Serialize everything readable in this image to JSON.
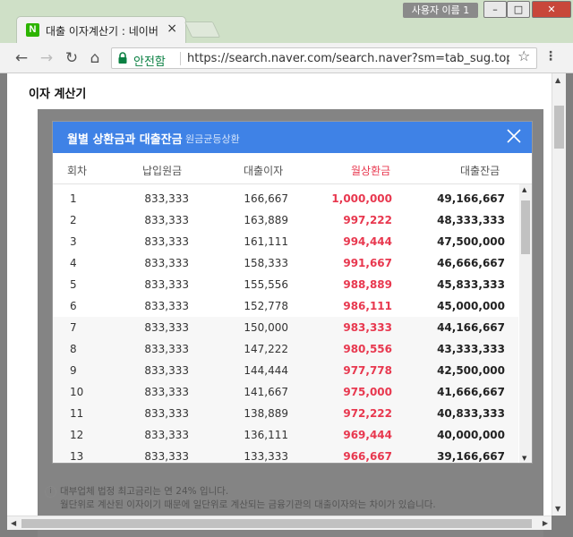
{
  "window": {
    "tab_title": "대출 이자계산기 : 네이버",
    "tab_close": "×",
    "profile": "사용자 이름 1",
    "min": "–",
    "max": "□",
    "close": "✕"
  },
  "toolbar": {
    "secure_label": "안전함",
    "url": "https://search.naver.com/search.naver?sm=tab_sug.top&..."
  },
  "page": {
    "title": "이자 계산기",
    "notes": [
      "대부업체 법정 최고금리는 연 24% 입니다.",
      "월단위로 계산된 이자이기 때문에 일단위로 계산되는 금융기관의 대출이자와는 차이가 있습니다."
    ]
  },
  "modal": {
    "title": "월별 상환금과 대출잔금",
    "subtitle": "원금균등상환",
    "columns": [
      "회차",
      "납입원금",
      "대출이자",
      "월상환금",
      "대출잔금"
    ],
    "rows": [
      [
        "1",
        "833,333",
        "166,667",
        "1,000,000",
        "49,166,667"
      ],
      [
        "2",
        "833,333",
        "163,889",
        "997,222",
        "48,333,333"
      ],
      [
        "3",
        "833,333",
        "161,111",
        "994,444",
        "47,500,000"
      ],
      [
        "4",
        "833,333",
        "158,333",
        "991,667",
        "46,666,667"
      ],
      [
        "5",
        "833,333",
        "155,556",
        "988,889",
        "45,833,333"
      ],
      [
        "6",
        "833,333",
        "152,778",
        "986,111",
        "45,000,000"
      ],
      [
        "7",
        "833,333",
        "150,000",
        "983,333",
        "44,166,667"
      ],
      [
        "8",
        "833,333",
        "147,222",
        "980,556",
        "43,333,333"
      ],
      [
        "9",
        "833,333",
        "144,444",
        "977,778",
        "42,500,000"
      ],
      [
        "10",
        "833,333",
        "141,667",
        "975,000",
        "41,666,667"
      ],
      [
        "11",
        "833,333",
        "138,889",
        "972,222",
        "40,833,333"
      ],
      [
        "12",
        "833,333",
        "136,111",
        "969,444",
        "40,000,000"
      ],
      [
        "13",
        "833,333",
        "133,333",
        "966,667",
        "39,166,667"
      ]
    ]
  },
  "colors": {
    "header_blue": "#3f82e6",
    "accent_red": "#e8384f",
    "secure_green": "#0b8043"
  }
}
